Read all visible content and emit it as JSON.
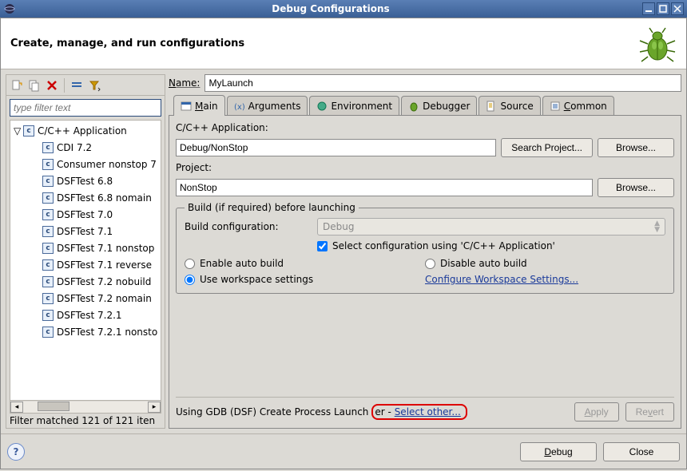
{
  "window": {
    "title": "Debug Configurations"
  },
  "header": {
    "title": "Create, manage, and run configurations"
  },
  "left": {
    "filter_placeholder": "type filter text",
    "root_label": "C/C++ Application",
    "items": [
      "CDI 7.2",
      "Consumer nonstop 7",
      "DSFTest 6.8",
      "DSFTest 6.8 nomain",
      "DSFTest 7.0",
      "DSFTest 7.1",
      "DSFTest 7.1 nonstop",
      "DSFTest 7.1 reverse",
      "DSFTest 7.2 nobuild",
      "DSFTest 7.2 nomain",
      "DSFTest 7.2.1",
      "DSFTest 7.2.1 nonsto"
    ],
    "status": "Filter matched 121 of 121 iten"
  },
  "right": {
    "name_label": "Name:",
    "name_value": "MyLaunch",
    "tabs": [
      "Main",
      "Arguments",
      "Environment",
      "Debugger",
      "Source",
      "Common"
    ],
    "active_tab": 0,
    "main": {
      "app_label": "C/C++ Application:",
      "app_value": "Debug/NonStop",
      "search_project_btn": "Search Project...",
      "browse_btn": "Browse...",
      "project_label": "Project:",
      "project_value": "NonStop",
      "build_legend": "Build (if required) before launching",
      "build_config_label": "Build configuration:",
      "build_config_value": "Debug",
      "select_using_app": "Select configuration using 'C/C++ Application'",
      "enable_auto": "Enable auto build",
      "disable_auto": "Disable auto build",
      "use_workspace": "Use workspace settings",
      "configure_workspace": "Configure Workspace Settings..."
    },
    "launcher_text": "Using GDB (DSF) Create Process Launcher - ",
    "select_other": "Select other...",
    "apply_btn": "Apply",
    "revert_btn": "Revert"
  },
  "footer": {
    "debug_btn": "Debug",
    "close_btn": "Close"
  }
}
